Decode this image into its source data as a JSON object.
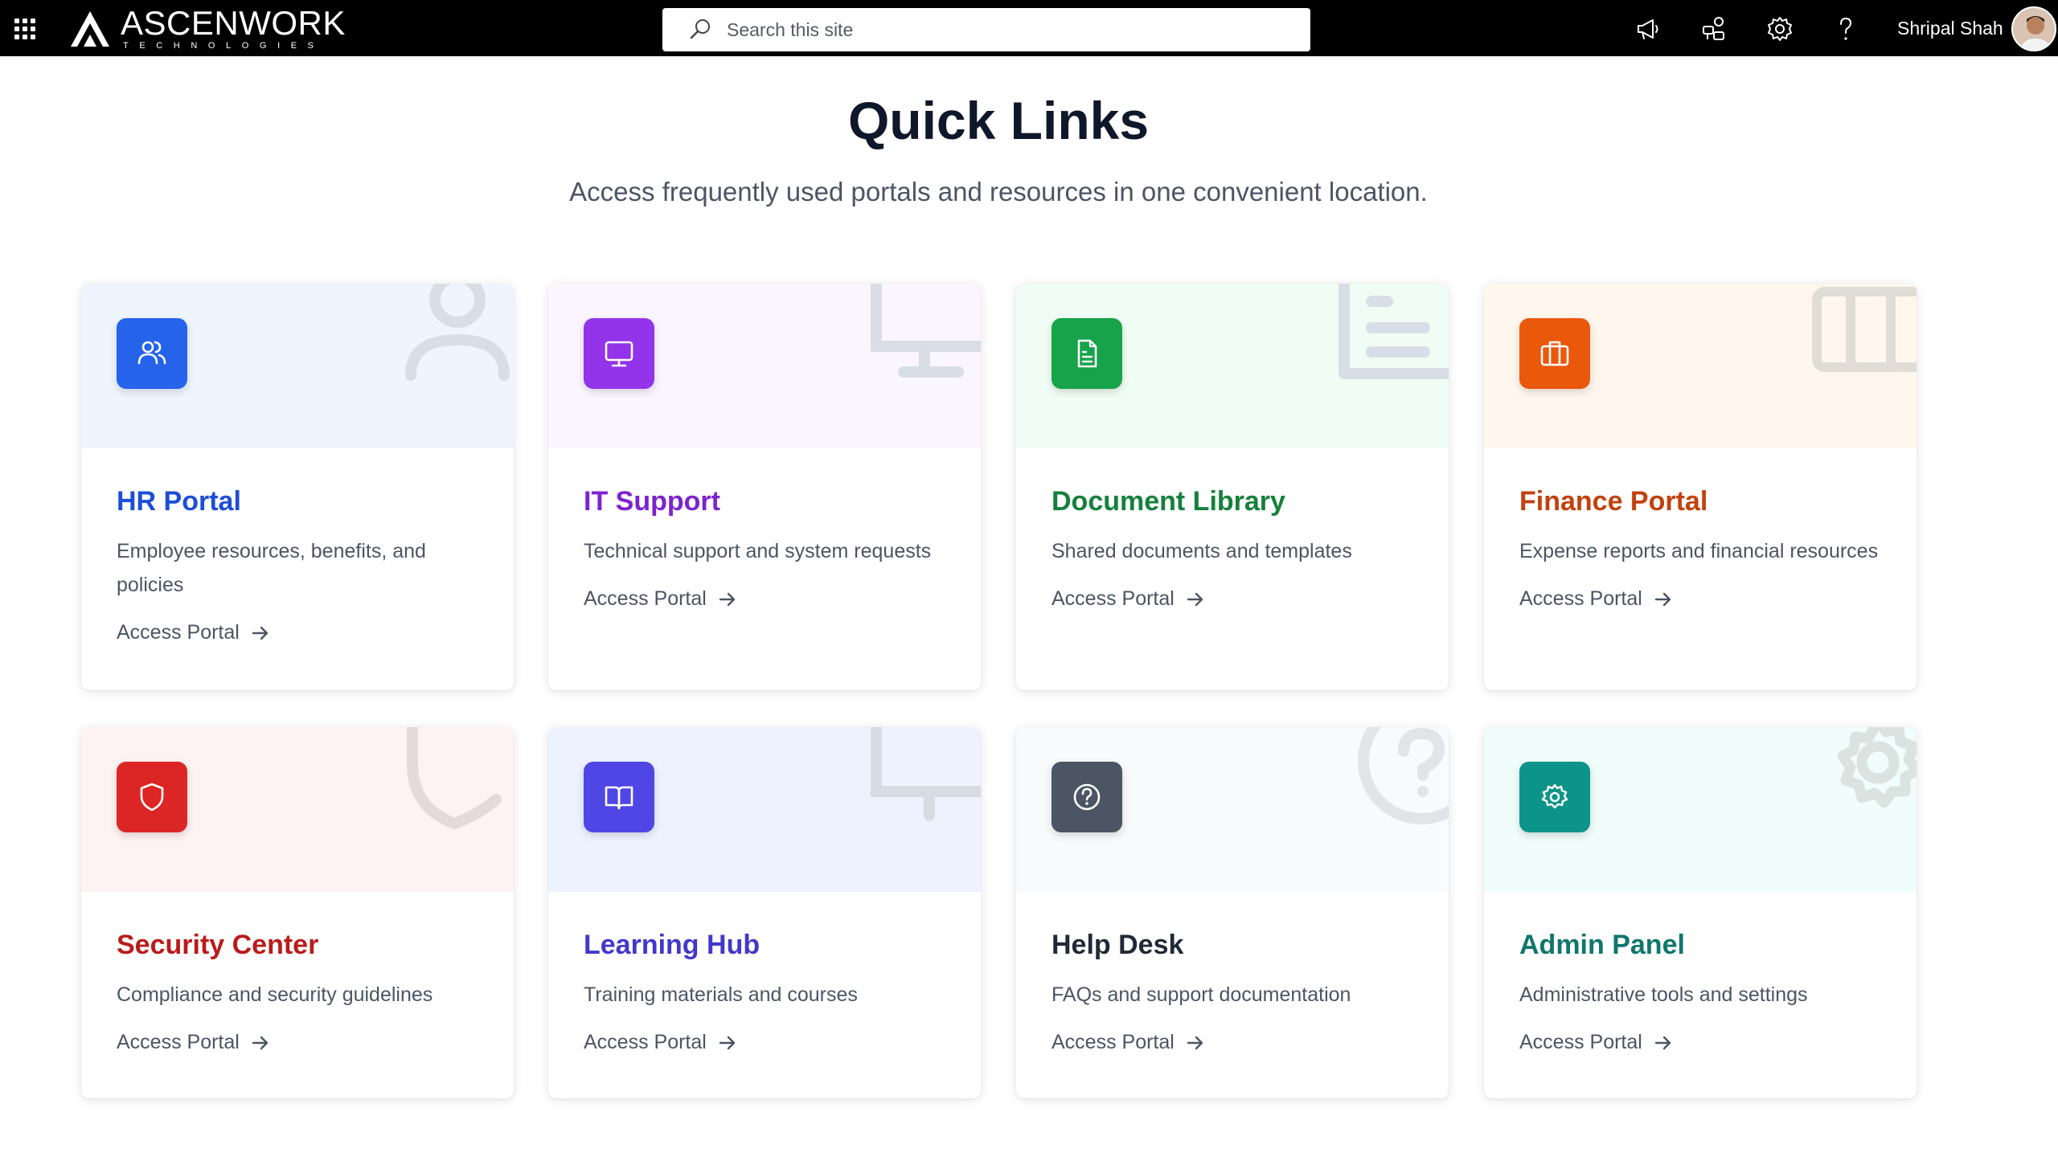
{
  "header": {
    "brand_name": "ASCENWORK",
    "brand_sub": "TECHNOLOGIES",
    "search_placeholder": "Search this site",
    "user_name": "Shripal Shah"
  },
  "page": {
    "title": "Quick Links",
    "subtitle": "Access frequently used portals and resources in one convenient location."
  },
  "cards": [
    {
      "title": "HR Portal",
      "description": "Employee resources, benefits, and policies",
      "link": "Access Portal",
      "icon": "users-icon",
      "accent": "#2563eb",
      "title_color": "#1d4ed8",
      "bg": "#eff5ff"
    },
    {
      "title": "IT Support",
      "description": "Technical support and system requests",
      "link": "Access Portal",
      "icon": "monitor-icon",
      "accent": "#9333ea",
      "title_color": "#7e22ce",
      "bg": "#faf5ff"
    },
    {
      "title": "Document Library",
      "description": "Shared documents and templates",
      "link": "Access Portal",
      "icon": "document-icon",
      "accent": "#16a34a",
      "title_color": "#15803d",
      "bg": "#f0fdf4"
    },
    {
      "title": "Finance Portal",
      "description": "Expense reports and financial resources",
      "link": "Access Portal",
      "icon": "briefcase-icon",
      "accent": "#ea580c",
      "title_color": "#c2410c",
      "bg": "#fff7ed"
    },
    {
      "title": "Security Center",
      "description": "Compliance and security guidelines",
      "link": "Access Portal",
      "icon": "shield-icon",
      "accent": "#dc2626",
      "title_color": "#b91c1c",
      "bg": "#fef2f2"
    },
    {
      "title": "Learning Hub",
      "description": "Training materials and courses",
      "link": "Access Portal",
      "icon": "book-icon",
      "accent": "#4f46e5",
      "title_color": "#4338ca",
      "bg": "#eef2ff"
    },
    {
      "title": "Help Desk",
      "description": "FAQs and support documentation",
      "link": "Access Portal",
      "icon": "help-icon",
      "accent": "#4b5563",
      "title_color": "#1f2937",
      "bg": "#f9fafb"
    },
    {
      "title": "Admin Panel",
      "description": "Administrative tools and settings",
      "link": "Access Portal",
      "icon": "gear-icon",
      "accent": "#0d9488",
      "title_color": "#0f766e",
      "bg": "#f0fdfa"
    }
  ]
}
